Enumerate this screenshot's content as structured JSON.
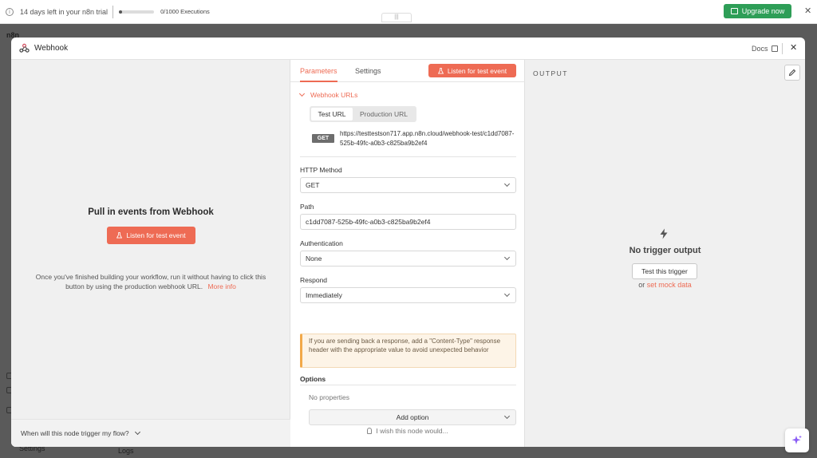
{
  "trial": {
    "days_left_text": "14 days left in your n8n trial",
    "executions_text": "0/1000 Executions",
    "executions_used_fraction": 0.0,
    "upgrade_label": "Upgrade now",
    "close_glyph": "✕"
  },
  "background": {
    "logo_text": "n8n",
    "settings_label": "Settings",
    "logs_label": "Logs"
  },
  "modal": {
    "title": "Webhook",
    "docs_label": "Docs",
    "close_glyph": "✕"
  },
  "input_panel": {
    "title": "Pull in events from Webhook",
    "listen_label": "Listen for test event",
    "description": "Once you've finished building your workflow, run it without having to click this button by using the production webhook URL.",
    "more_info_label": "More info",
    "flow_question": "When will this node trigger my flow?"
  },
  "params_panel": {
    "drag_handle_glyph": "|||",
    "tabs": [
      {
        "label": "Parameters",
        "active": true
      },
      {
        "label": "Settings",
        "active": false
      }
    ],
    "listen_label": "Listen for test event",
    "webhook_urls_label": "Webhook URLs",
    "url_toggle": {
      "options": [
        "Test URL",
        "Production URL"
      ],
      "selected": "Test URL"
    },
    "method_badge": "GET",
    "url": "https://testtestson717.app.n8n.cloud/webhook-test/c1dd7087-525b-49fc-a0b3-c825ba9b2ef4",
    "fields": {
      "http_method": {
        "label": "HTTP Method",
        "value": "GET"
      },
      "path": {
        "label": "Path",
        "value": "c1dd7087-525b-49fc-a0b3-c825ba9b2ef4"
      },
      "authentication": {
        "label": "Authentication",
        "value": "None"
      },
      "respond": {
        "label": "Respond",
        "value": "Immediately"
      }
    },
    "notice": "If you are sending back a response, add a \"Content-Type\" response header with the appropriate value to avoid unexpected behavior",
    "options_label": "Options",
    "no_properties": "No properties",
    "add_option_label": "Add option",
    "wish_label": "I wish this node would..."
  },
  "output_panel": {
    "title": "OUTPUT",
    "no_output": "No trigger output",
    "test_trigger_label": "Test this trigger",
    "or_text": "or",
    "mock_label": "set mock data"
  },
  "colors": {
    "accent": "#ee6b54",
    "upgrade_green": "#2e9e57",
    "notice_border": "#f2a94a"
  },
  "icons": {
    "info": "info-icon",
    "gift": "gift-icon",
    "webhook": "webhook-icon",
    "external": "external-link-icon",
    "flask": "flask-icon",
    "chevron": "chevron-down-icon",
    "bulb": "lightbulb-icon",
    "pencil": "pencil-icon",
    "bolt": "lightning-icon",
    "sparkle": "sparkle-icon"
  }
}
